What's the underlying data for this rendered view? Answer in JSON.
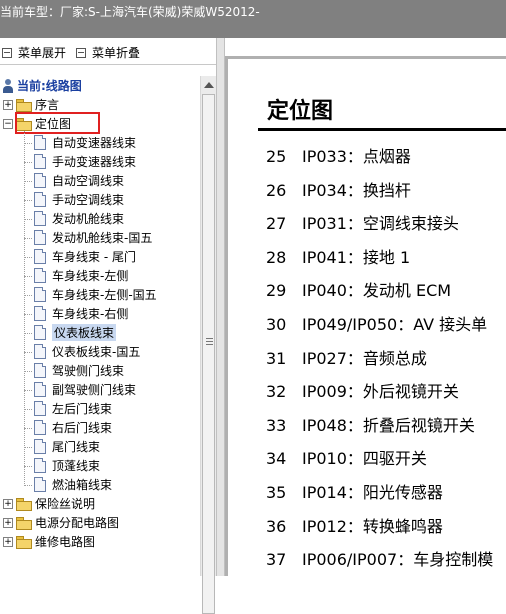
{
  "title_bar": {
    "text": "当前车型：厂家:S-上海汽车(荣威)荣威W52012-"
  },
  "toolbar": {
    "expand_label": "菜单展开",
    "collapse_label": "菜单折叠"
  },
  "tree": {
    "root_label": "当前:线路图",
    "folders_top": [
      {
        "label": "序言",
        "expanded": false
      },
      {
        "label": "定位图",
        "expanded": true,
        "highlighted": true
      }
    ],
    "children": [
      "自动变速器线束",
      "手动变速器线束",
      "自动空调线束",
      "手动空调线束",
      "发动机舱线束",
      "发动机舱线束-国五",
      "车身线束 - 尾门",
      "车身线束-左侧",
      "车身线束-左侧-国五",
      "车身线束-右侧",
      "仪表板线束",
      "仪表板线束-国五",
      "驾驶侧门线束",
      "副驾驶侧门线束",
      "左后门线束",
      "右后门线束",
      "尾门线束",
      "顶蓬线束",
      "燃油箱线束"
    ],
    "selected_child": "仪表板线束",
    "folders_bottom": [
      "保险丝说明",
      "电源分配电路图",
      "维修电路图"
    ],
    "plus": "+",
    "minus": "−"
  },
  "document": {
    "title": "定位图",
    "entries": [
      {
        "num": "25",
        "text": "IP033：点烟器"
      },
      {
        "num": "26",
        "text": "IP034：换挡杆"
      },
      {
        "num": "27",
        "text": "IP031：空调线束接头"
      },
      {
        "num": "28",
        "text": "IP041：接地 1"
      },
      {
        "num": "29",
        "text": "IP040：发动机 ECM"
      },
      {
        "num": "30",
        "text": "IP049/IP050：AV 接头单"
      },
      {
        "num": "31",
        "text": "IP027：音频总成"
      },
      {
        "num": "32",
        "text": "IP009：外后视镜开关"
      },
      {
        "num": "33",
        "text": "IP048：折叠后视镜开关"
      },
      {
        "num": "34",
        "text": "IP010：四驱开关"
      },
      {
        "num": "35",
        "text": "IP014：阳光传感器"
      },
      {
        "num": "36",
        "text": "IP012：转换蜂鸣器"
      },
      {
        "num": "37",
        "text": "IP006/IP007：车身控制模"
      }
    ]
  },
  "colors": {
    "title_bar": "#808080",
    "highlight_box": "#e02020",
    "root_label": "#1a3fa0",
    "selection": "#c8d8f0"
  }
}
